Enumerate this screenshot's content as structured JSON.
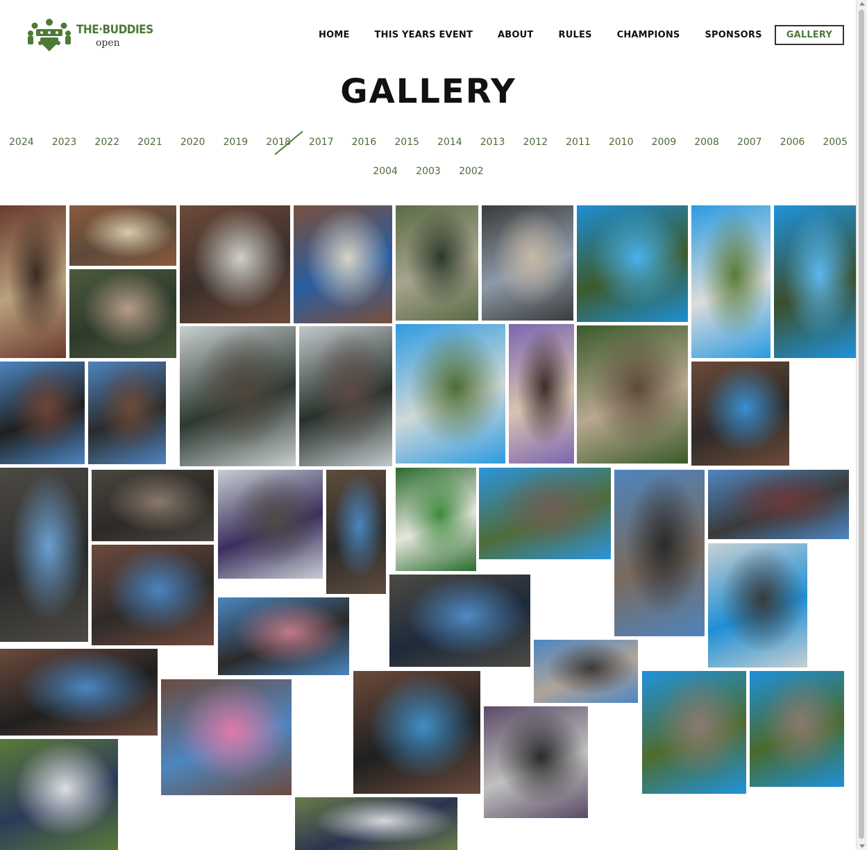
{
  "brand": {
    "name_top": "THE·BUDDIES",
    "name_bottom": "open",
    "accent_color": "#4d7a36"
  },
  "nav": {
    "items": [
      {
        "label": "HOME",
        "active": false
      },
      {
        "label": "THIS YEARS EVENT",
        "active": false
      },
      {
        "label": "ABOUT",
        "active": false
      },
      {
        "label": "RULES",
        "active": false
      },
      {
        "label": "CHAMPIONS",
        "active": false
      },
      {
        "label": "SPONSORS",
        "active": false
      },
      {
        "label": "GALLERY",
        "active": true
      }
    ]
  },
  "page": {
    "title": "GALLERY"
  },
  "years": {
    "row1": [
      "2024",
      "2023",
      "2022",
      "2021",
      "2020",
      "2019",
      "2018",
      "2017",
      "2016",
      "2015",
      "2014",
      "2013",
      "2012",
      "2011",
      "2010",
      "2009",
      "2008",
      "2007",
      "2006",
      "2005"
    ],
    "row2": [
      "2004",
      "2003",
      "2002"
    ],
    "current": "2018"
  },
  "gallery": {
    "photos": [
      {
        "name": "photo-patio-boxes",
        "palette": [
          "#6b3a2e",
          "#3c2a22",
          "#b9a27d"
        ]
      },
      {
        "name": "photo-prize-boxes",
        "palette": [
          "#8a5a3c",
          "#d9c9a8",
          "#5d4a3a"
        ]
      },
      {
        "name": "photo-man-grey-jacket",
        "palette": [
          "#6e4a3a",
          "#cfd0c8",
          "#3a2f2a"
        ]
      },
      {
        "name": "photo-man-banner",
        "palette": [
          "#7a4f3c",
          "#d8d3c5",
          "#2a5ea0"
        ]
      },
      {
        "name": "photo-golf-cart",
        "palette": [
          "#5a6b46",
          "#2c3a2a",
          "#a7a48e"
        ]
      },
      {
        "name": "photo-selfie-cap",
        "palette": [
          "#3a3a3a",
          "#c7b8a6",
          "#8c9aa8"
        ]
      },
      {
        "name": "photo-pool-swimmers",
        "palette": [
          "#1e8fd6",
          "#49b2ec",
          "#3d5a2c"
        ]
      },
      {
        "name": "photo-pool-tent",
        "palette": [
          "#2a9be0",
          "#5a7c3a",
          "#dcdcdc"
        ]
      },
      {
        "name": "photo-pool-chairs",
        "palette": [
          "#1f93dc",
          "#5bb8ee",
          "#3b4e2a"
        ]
      },
      {
        "name": "photo-buffet-crowd",
        "palette": [
          "#4c5a3e",
          "#b89c8a",
          "#2e3a2a"
        ]
      },
      {
        "name": "photo-tent-party",
        "palette": [
          "#c8cfd0",
          "#4e463c",
          "#2d3830"
        ]
      },
      {
        "name": "photo-tent-crowd",
        "palette": [
          "#c2c9cc",
          "#5b4a44",
          "#27302a"
        ]
      },
      {
        "name": "photo-certificate-1",
        "palette": [
          "#4d86c2",
          "#6e4436",
          "#1f1f1f"
        ]
      },
      {
        "name": "photo-certificate-2",
        "palette": [
          "#4f84bf",
          "#6b4a3a",
          "#2a2a2a"
        ]
      },
      {
        "name": "photo-pool-guests",
        "palette": [
          "#2f9be0",
          "#4f6e33",
          "#cfd8d8"
        ]
      },
      {
        "name": "photo-selfie-hat",
        "palette": [
          "#7c66b0",
          "#3a2e2a",
          "#d8c3b0"
        ]
      },
      {
        "name": "photo-backyard-seating",
        "palette": [
          "#3a5a2a",
          "#5d4a3a",
          "#b8a890"
        ]
      },
      {
        "name": "photo-musician",
        "palette": [
          "#6b4b3a",
          "#3a8fd0",
          "#2e2a28"
        ]
      },
      {
        "name": "photo-speech-mic",
        "palette": [
          "#4d4a44",
          "#6aa0d0",
          "#2a2a2a"
        ]
      },
      {
        "name": "photo-patio-crowd",
        "palette": [
          "#4a4640",
          "#8a7a6c",
          "#2c2a26"
        ]
      },
      {
        "name": "photo-tent-wide",
        "palette": [
          "#c7ced2",
          "#4e4a46",
          "#3b2e5e"
        ]
      },
      {
        "name": "photo-trophy-pair",
        "palette": [
          "#5f4c3e",
          "#4b86c0",
          "#2b2a28"
        ]
      },
      {
        "name": "photo-cake",
        "palette": [
          "#2a6b2e",
          "#3f8a3e",
          "#e6e6de"
        ]
      },
      {
        "name": "photo-pool-group",
        "palette": [
          "#2c95dc",
          "#6f5e54",
          "#4f6c3a"
        ]
      },
      {
        "name": "photo-winners-patio",
        "palette": [
          "#4e84be",
          "#2a2a2a",
          "#7a6a5c"
        ]
      },
      {
        "name": "photo-statue-award",
        "palette": [
          "#4e86c2",
          "#6a3a3a",
          "#3a3a3a"
        ]
      },
      {
        "name": "photo-speaker-patio",
        "palette": [
          "#6e4a3c",
          "#4a84c0",
          "#2e2a2a"
        ]
      },
      {
        "name": "photo-ladies-group",
        "palette": [
          "#4a86c0",
          "#c07a8a",
          "#2a2a2a"
        ]
      },
      {
        "name": "photo-trophy-trio",
        "palette": [
          "#4c4a44",
          "#4f8ac4",
          "#1e2a3a"
        ]
      },
      {
        "name": "photo-patio-tent",
        "palette": [
          "#c8d0d2",
          "#3a3a3a",
          "#1f8fd6"
        ]
      },
      {
        "name": "photo-award-certificate",
        "palette": [
          "#6b4a3c",
          "#4b86c0",
          "#1f1f1f"
        ]
      },
      {
        "name": "photo-girls-group",
        "palette": [
          "#6c4a3c",
          "#e07aa6",
          "#4c86c0"
        ]
      },
      {
        "name": "photo-mic-award",
        "palette": [
          "#4c86c0",
          "#3a3a3a",
          "#b0a49a"
        ]
      },
      {
        "name": "photo-award-presentation",
        "palette": [
          "#6a4a3c",
          "#3f8fc8",
          "#1f1f1f"
        ]
      },
      {
        "name": "photo-dj-table",
        "palette": [
          "#5a4a66",
          "#2a2a2a",
          "#c0c0c0"
        ]
      },
      {
        "name": "photo-pool-crowd-1",
        "palette": [
          "#1f93dc",
          "#8a7a70",
          "#4e6c2e"
        ]
      },
      {
        "name": "photo-pool-crowd-2",
        "palette": [
          "#1d91da",
          "#8a7a70",
          "#4a6a2c"
        ]
      },
      {
        "name": "photo-golf-group",
        "palette": [
          "#5b7a3a",
          "#dcdfe2",
          "#2c3a5a"
        ]
      },
      {
        "name": "photo-golf-group-2",
        "palette": [
          "#6a7c4a",
          "#d7dadc",
          "#2a3450"
        ]
      }
    ]
  }
}
